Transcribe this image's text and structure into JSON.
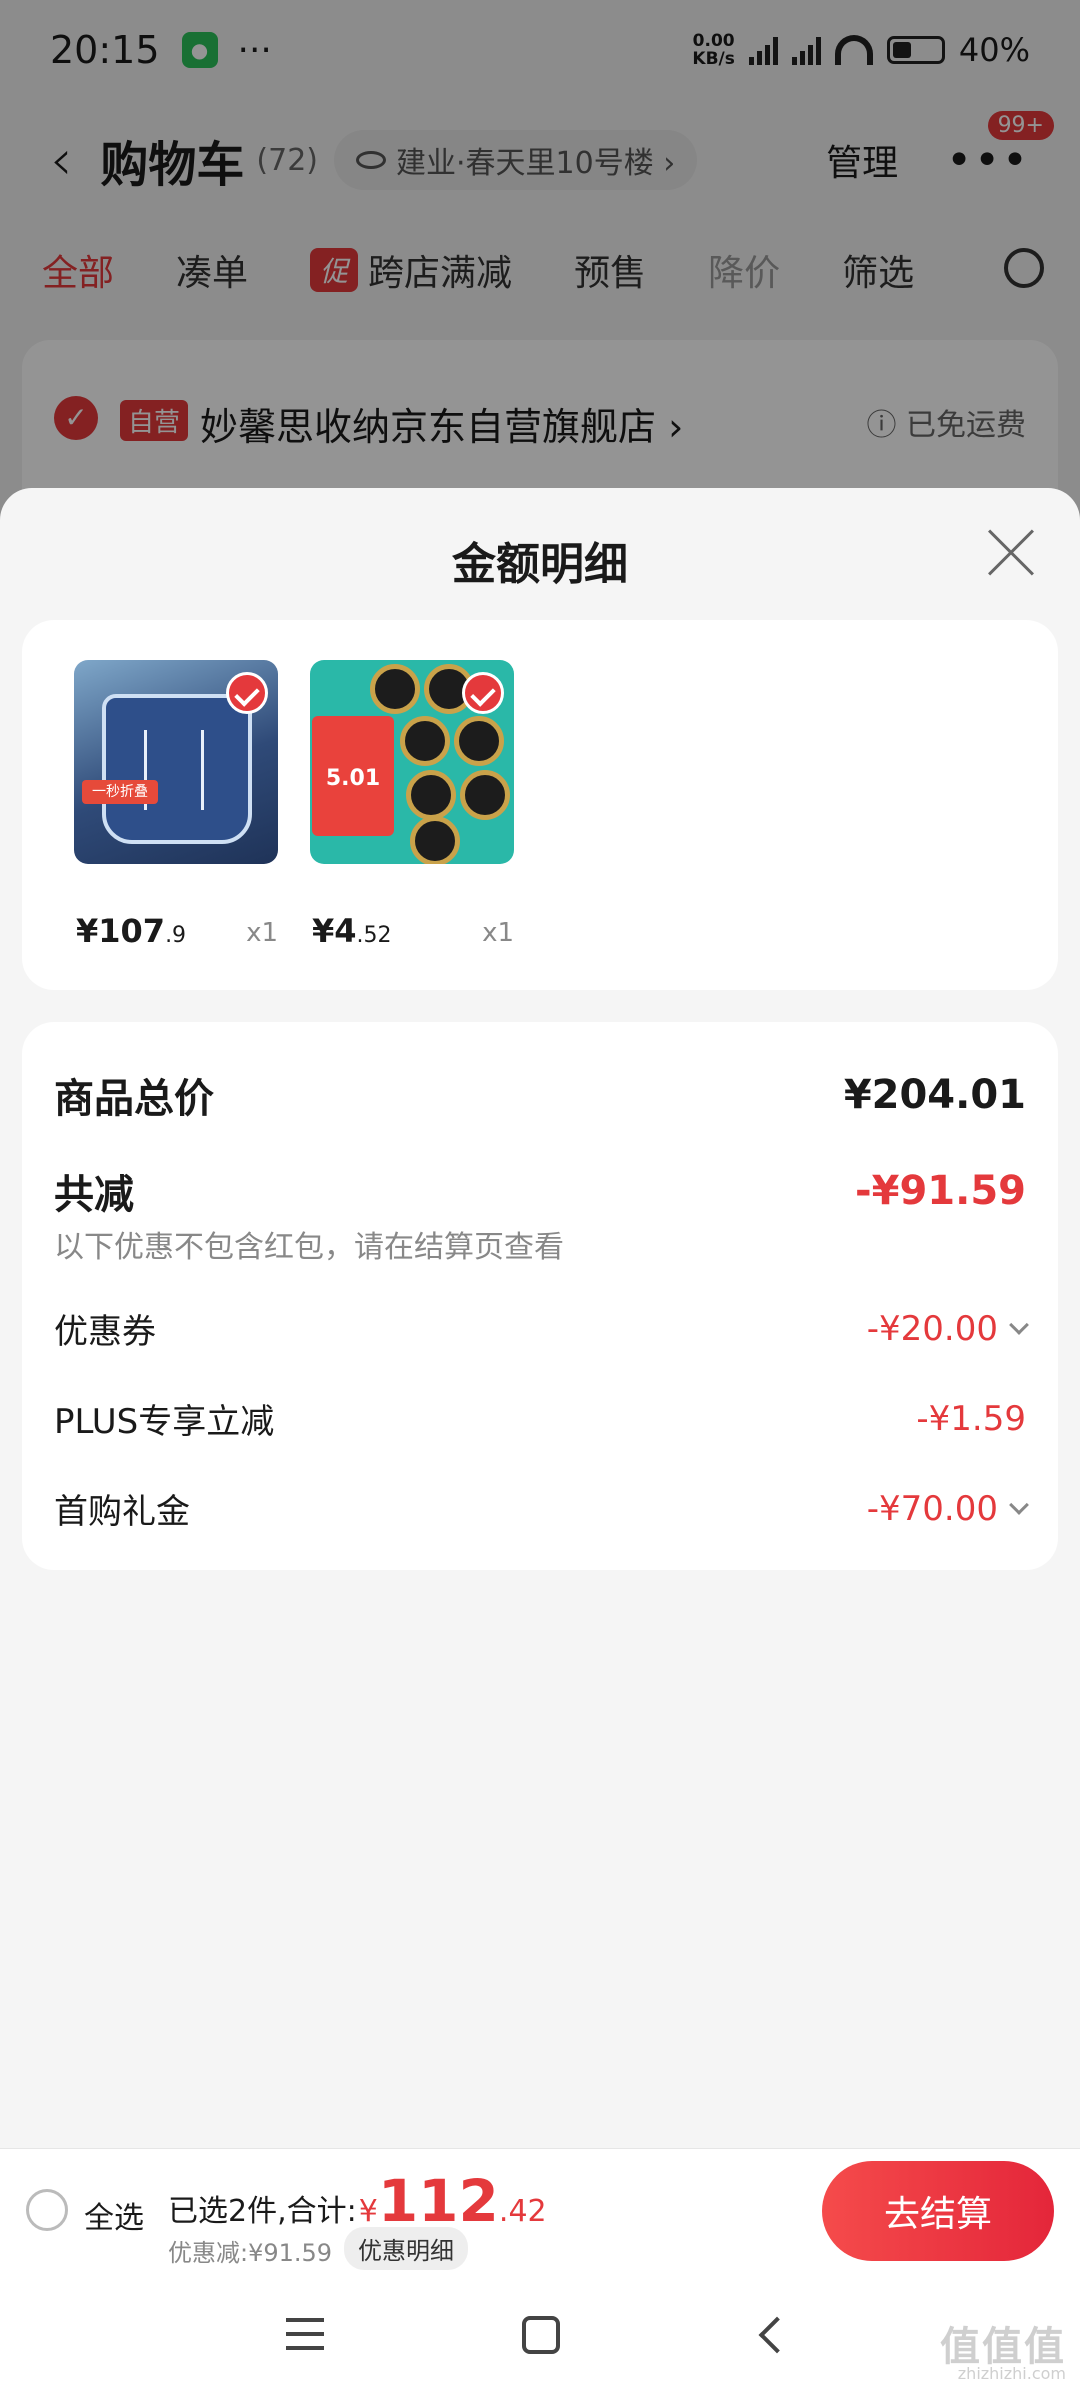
{
  "status_bar": {
    "time": "20:15",
    "net_speed_value": "0.00",
    "net_speed_unit": "KB/s",
    "battery": "40%"
  },
  "header": {
    "title": "购物车",
    "count": "(72)",
    "address": "建业·春天里10号楼 ›",
    "manage": "管理",
    "badge": "99+"
  },
  "tabs": [
    {
      "label": "全部"
    },
    {
      "label": "凑单"
    },
    {
      "label": "跨店满减",
      "tag": "促"
    },
    {
      "label": "预售"
    },
    {
      "label": "降价"
    },
    {
      "label": "筛选"
    }
  ],
  "store": {
    "self_tag": "自营",
    "name": "妙馨思收纳京东自营旗舰店 ›",
    "shipping": "ⓘ 已免运费"
  },
  "sheet": {
    "title": "金额明细",
    "products": [
      {
        "price_int": "¥107",
        "price_dec": ".9",
        "qty": "x1"
      },
      {
        "price_int": "¥4",
        "price_dec": ".52",
        "qty": "x1"
      }
    ],
    "product_tag_1": "一秒折叠",
    "product_tag_2": "5.01",
    "total_label": "商品总价",
    "total_value": "¥204.01",
    "reduce_label": "共减",
    "reduce_value": "-¥91.59",
    "note": "以下优惠不包含红包，请在结算页查看",
    "items": [
      {
        "label": "优惠券",
        "value": "-¥20.00"
      },
      {
        "label": "PLUS专享立减",
        "value": "-¥1.59"
      },
      {
        "label": "首购礼金",
        "value": "-¥70.00"
      }
    ]
  },
  "bottom_bar": {
    "select_all": "全选",
    "selected_text": "已选2件,合计:",
    "currency": "¥",
    "total_int": "112",
    "total_dec": ".42",
    "discount_text": "优惠减:¥91.59",
    "detail_button": "优惠明细",
    "checkout_button": "去结算"
  },
  "watermark": {
    "text": "值值值",
    "url": "zhizhizhi.com"
  },
  "colors": {
    "accent_red": "#e4393c",
    "sheet_bg": "#f5f5f5"
  }
}
